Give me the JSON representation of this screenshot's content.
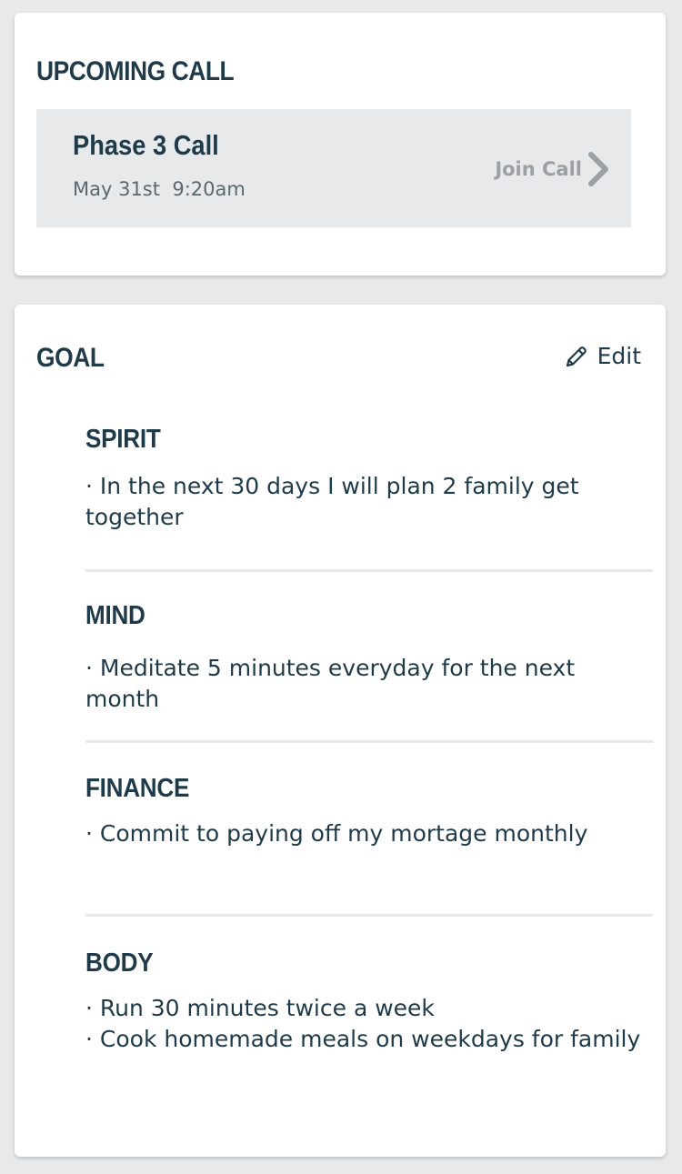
{
  "upcoming": {
    "title": "UPCOMING CALL",
    "call": {
      "name": "Phase 3 Call",
      "time": "May 31st  9:20am",
      "action_label": "Join Call"
    }
  },
  "goal": {
    "title": "GOAL",
    "edit_label": "Edit",
    "sections": [
      {
        "heading": "SPIRIT",
        "items": [
          "· In the next 30 days I will plan 2 family get together"
        ]
      },
      {
        "heading": "MIND",
        "items": [
          "· Meditate 5 minutes everyday for the next month"
        ]
      },
      {
        "heading": "FINANCE",
        "items": [
          "· Commit to paying off my mortage monthly"
        ]
      },
      {
        "heading": "BODY",
        "items": [
          "· Run 30 minutes twice a week",
          "· Cook homemade meals on weekdays for family"
        ]
      }
    ]
  },
  "icons": {
    "join": "chevron-right-icon",
    "edit": "pencil-icon"
  },
  "colors": {
    "background": "#e8e9eb",
    "card": "#ffffff",
    "text": "#1f3a48",
    "muted": "#9aa0a4"
  }
}
